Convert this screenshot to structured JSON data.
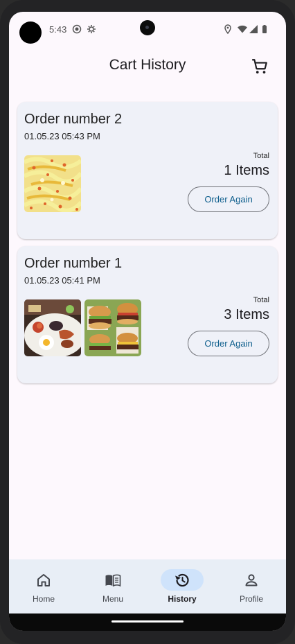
{
  "status_bar": {
    "time": "5:43"
  },
  "app_bar": {
    "title": "Cart History",
    "cart_icon": "shopping-cart-icon"
  },
  "orders": [
    {
      "title": "Order number 2",
      "date": "01.05.23 05:43 PM",
      "total_label": "Total",
      "item_count": "1 Items",
      "button_label": "Order Again",
      "images": [
        "pasta-image"
      ]
    },
    {
      "title": "Order number 1",
      "date": "01.05.23 05:41 PM",
      "total_label": "Total",
      "item_count": "3 Items",
      "button_label": "Order Again",
      "images": [
        "breakfast-image",
        "burgers-image"
      ]
    }
  ],
  "bottom_nav": {
    "items": [
      {
        "label": "Home",
        "icon": "home-icon",
        "active": false
      },
      {
        "label": "Menu",
        "icon": "menu-book-icon",
        "active": false
      },
      {
        "label": "History",
        "icon": "history-icon",
        "active": true
      },
      {
        "label": "Profile",
        "icon": "person-icon",
        "active": false
      }
    ]
  },
  "colors": {
    "background": "#fdf8fd",
    "card": "#eff1f8",
    "button_text": "#0d5e8c",
    "nav_background": "#e8eef6",
    "nav_active_pill": "#cfe3fb"
  }
}
